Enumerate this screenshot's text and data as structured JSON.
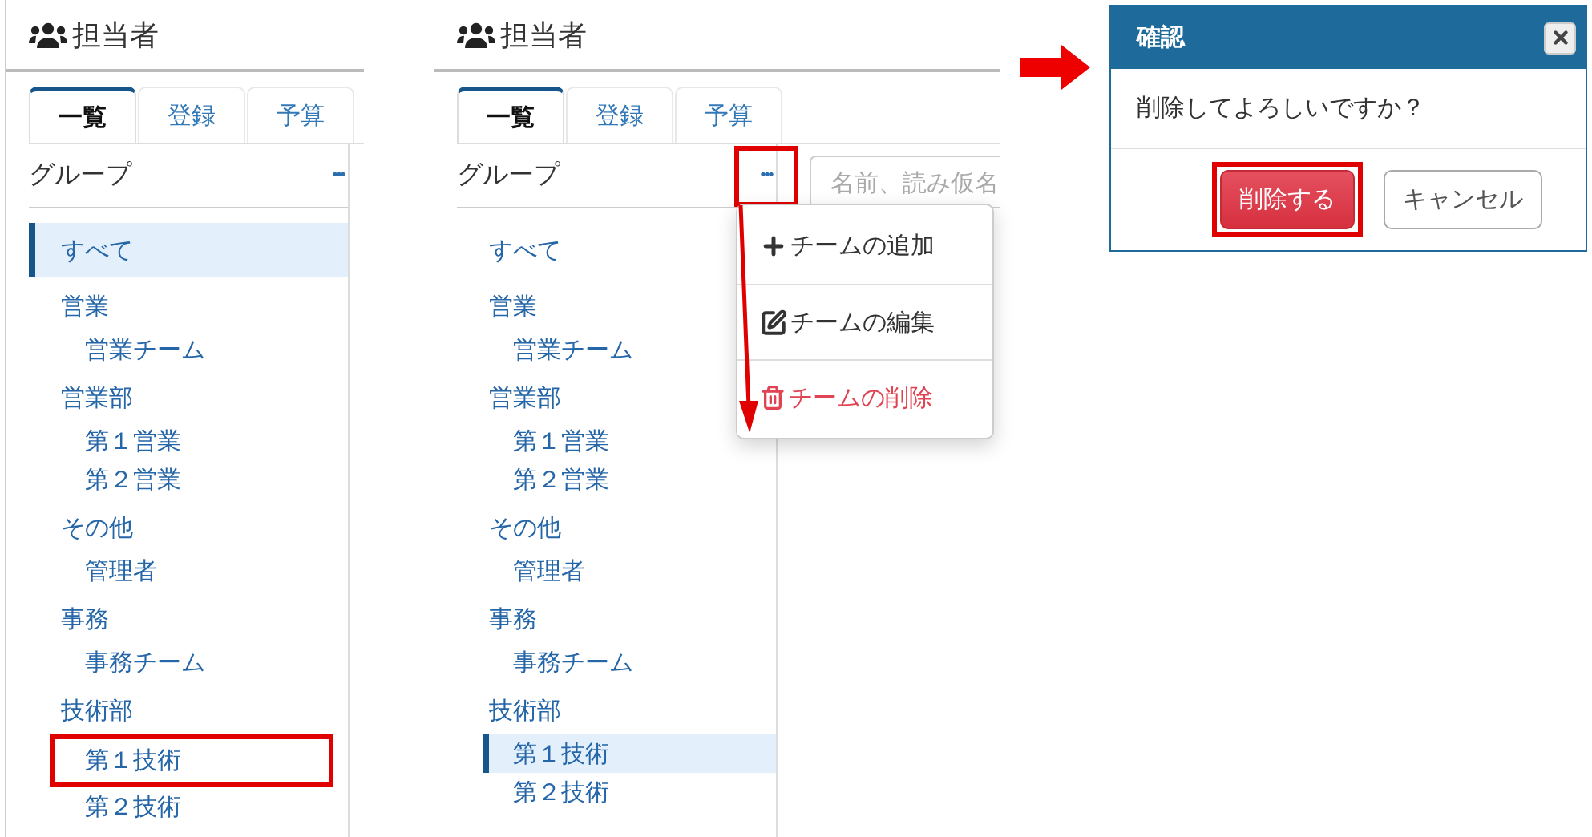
{
  "panels": [
    {
      "title": "担当者",
      "tabs": [
        {
          "label": "一覧",
          "selected": true
        },
        {
          "label": "登録",
          "selected": false
        },
        {
          "label": "予算",
          "selected": false
        }
      ],
      "group_label": "グループ",
      "more_button": {
        "label": "•••",
        "highlighted": false
      },
      "groups": [
        {
          "label": "すべて",
          "selected": true,
          "highlighted": false
        },
        {
          "label": "営業",
          "selected": false,
          "highlighted": false,
          "children": [
            {
              "label": "営業チーム",
              "selected": false,
              "highlighted": false
            }
          ]
        },
        {
          "label": "営業部",
          "selected": false,
          "highlighted": false,
          "children": [
            {
              "label": "第１営業",
              "selected": false,
              "highlighted": false
            },
            {
              "label": "第２営業",
              "selected": false,
              "highlighted": false
            }
          ]
        },
        {
          "label": "その他",
          "selected": false,
          "highlighted": false,
          "children": [
            {
              "label": "管理者",
              "selected": false,
              "highlighted": false
            }
          ]
        },
        {
          "label": "事務",
          "selected": false,
          "highlighted": false,
          "children": [
            {
              "label": "事務チーム",
              "selected": false,
              "highlighted": false
            }
          ]
        },
        {
          "label": "技術部",
          "selected": false,
          "highlighted": false,
          "children": [
            {
              "label": "第１技術",
              "selected": false,
              "highlighted": true
            },
            {
              "label": "第２技術",
              "selected": false,
              "highlighted": false
            }
          ]
        }
      ]
    },
    {
      "title": "担当者",
      "tabs": [
        {
          "label": "一覧",
          "selected": true
        },
        {
          "label": "登録",
          "selected": false
        },
        {
          "label": "予算",
          "selected": false
        }
      ],
      "group_label": "グループ",
      "more_button": {
        "label": "•••",
        "highlighted": true
      },
      "search": {
        "placeholder": "名前、読み仮名"
      },
      "menu": [
        {
          "label": "チームの追加",
          "kind": "add",
          "danger": false
        },
        {
          "label": "チームの編集",
          "kind": "edit",
          "danger": false
        },
        {
          "label": "チームの削除",
          "kind": "delete",
          "danger": true
        }
      ],
      "groups": [
        {
          "label": "すべて",
          "selected": false,
          "highlighted": false
        },
        {
          "label": "営業",
          "selected": false,
          "highlighted": false,
          "children": [
            {
              "label": "営業チーム",
              "selected": false,
              "highlighted": false
            }
          ]
        },
        {
          "label": "営業部",
          "selected": false,
          "highlighted": false,
          "children": [
            {
              "label": "第１営業",
              "selected": false,
              "highlighted": false
            },
            {
              "label": "第２営業",
              "selected": false,
              "highlighted": false
            }
          ]
        },
        {
          "label": "その他",
          "selected": false,
          "highlighted": false,
          "children": [
            {
              "label": "管理者",
              "selected": false,
              "highlighted": false
            }
          ]
        },
        {
          "label": "事務",
          "selected": false,
          "highlighted": false,
          "children": [
            {
              "label": "事務チーム",
              "selected": false,
              "highlighted": false
            }
          ]
        },
        {
          "label": "技術部",
          "selected": false,
          "highlighted": false,
          "children": [
            {
              "label": "第１技術",
              "selected": true,
              "highlighted": false
            },
            {
              "label": "第２技術",
              "selected": false,
              "highlighted": false
            }
          ]
        }
      ]
    }
  ],
  "dialog": {
    "title": "確認",
    "message": "削除してよろしいですか？",
    "buttons": [
      {
        "label": "削除する",
        "kind": "danger",
        "highlighted": true
      },
      {
        "label": "キャンセル",
        "kind": "default",
        "highlighted": false
      }
    ]
  }
}
